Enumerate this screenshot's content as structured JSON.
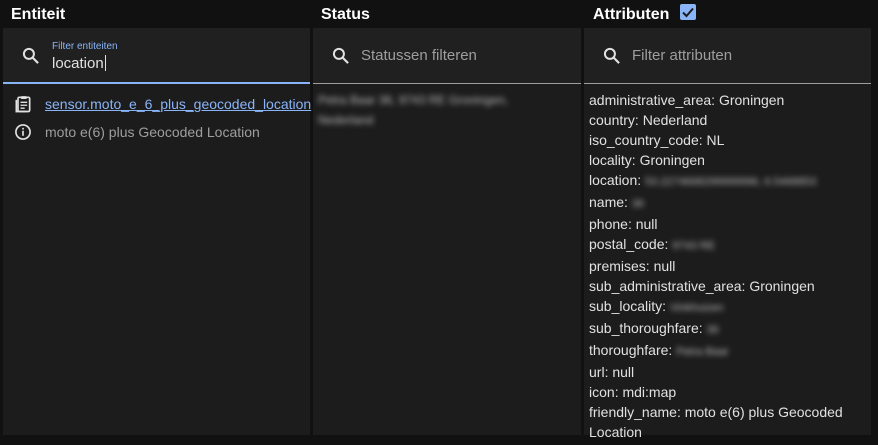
{
  "headers": {
    "entity": "Entiteit",
    "status": "Status",
    "attributes": "Attributen"
  },
  "filters": {
    "entity_label": "Filter entiteiten",
    "entity_value": "location",
    "status_placeholder": "Statussen filteren",
    "attributes_placeholder": "Filter attributen"
  },
  "entity": {
    "entity_id": "sensor.moto_e_6_plus_geocoded_location",
    "friendly_name": "moto e(6) plus Geocoded Location"
  },
  "status_value": "Petra Baar 36, 9743 RE Groningen, Nederland",
  "attributes": [
    {
      "key": "administrative_area",
      "value": "Groningen"
    },
    {
      "key": "country",
      "value": "Nederland"
    },
    {
      "key": "iso_country_code",
      "value": "NL"
    },
    {
      "key": "locality",
      "value": "Groningen"
    },
    {
      "key": "location",
      "value": "53.2274668299999996, 6.5468853",
      "redacted": true
    },
    {
      "key": "name",
      "value": "36",
      "redacted": true
    },
    {
      "key": "phone",
      "value": "null"
    },
    {
      "key": "postal_code",
      "value": "9743 RE",
      "redacted": true
    },
    {
      "key": "premises",
      "value": "null"
    },
    {
      "key": "sub_administrative_area",
      "value": "Groningen"
    },
    {
      "key": "sub_locality",
      "value": "Vinkhuizen",
      "redacted": true
    },
    {
      "key": "sub_thoroughfare",
      "value": "36",
      "redacted": true
    },
    {
      "key": "thoroughfare",
      "value": "Petra Baar",
      "redacted": true
    },
    {
      "key": "url",
      "value": "null"
    },
    {
      "key": "icon",
      "value": "mdi:map"
    },
    {
      "key": "friendly_name",
      "value": "moto e(6) plus Geocoded Location"
    }
  ],
  "colors": {
    "accent": "#8ab4f8",
    "background": "#111111",
    "panel": "#1c1c1c"
  },
  "icons": [
    "search-icon",
    "clipboard-icon",
    "info-icon",
    "checkbox-checked-icon"
  ]
}
